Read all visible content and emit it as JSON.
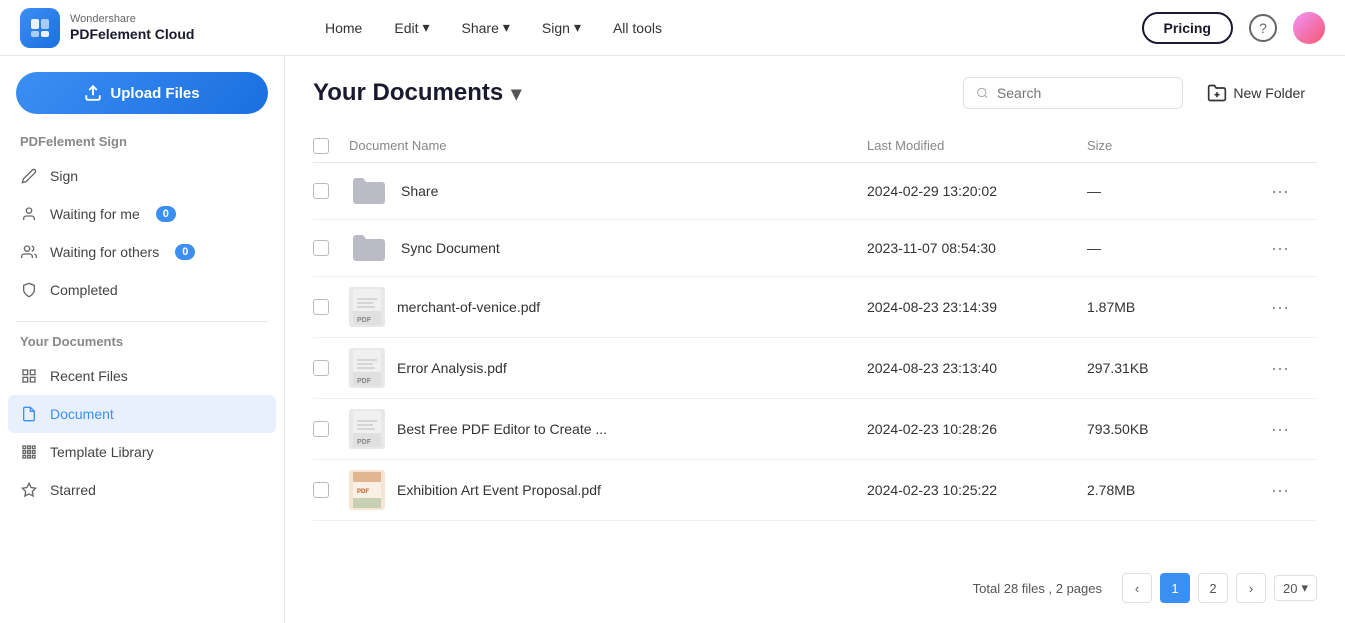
{
  "app": {
    "brand": "Wondershare",
    "product": "PDFelement Cloud"
  },
  "nav": {
    "links": [
      {
        "label": "Home",
        "has_arrow": false
      },
      {
        "label": "Edit",
        "has_arrow": true
      },
      {
        "label": "Share",
        "has_arrow": true
      },
      {
        "label": "Sign",
        "has_arrow": true
      },
      {
        "label": "All tools",
        "has_arrow": false
      }
    ],
    "pricing_label": "Pricing",
    "help_icon": "?",
    "upload_label": "Upload Files"
  },
  "sidebar": {
    "sign_section_label": "PDFelement Sign",
    "sign_items": [
      {
        "id": "sign",
        "label": "Sign"
      },
      {
        "id": "waiting-for-me",
        "label": "Waiting for me",
        "badge": "0"
      },
      {
        "id": "waiting-for-others",
        "label": "Waiting for others",
        "badge": "0"
      },
      {
        "id": "completed",
        "label": "Completed"
      }
    ],
    "docs_section_label": "Your Documents",
    "doc_items": [
      {
        "id": "recent-files",
        "label": "Recent Files"
      },
      {
        "id": "document",
        "label": "Document",
        "active": true
      },
      {
        "id": "template-library",
        "label": "Template Library"
      },
      {
        "id": "starred",
        "label": "Starred"
      }
    ]
  },
  "content": {
    "title": "Your Documents",
    "search_placeholder": "Search",
    "new_folder_label": "New Folder",
    "columns": {
      "name": "Document Name",
      "modified": "Last Modified",
      "size": "Size"
    },
    "files": [
      {
        "id": 1,
        "name": "Share",
        "type": "folder",
        "modified": "2024-02-29 13:20:02",
        "size": "—"
      },
      {
        "id": 2,
        "name": "Sync Document",
        "type": "folder",
        "modified": "2023-11-07 08:54:30",
        "size": "—"
      },
      {
        "id": 3,
        "name": "merchant-of-venice.pdf",
        "type": "pdf",
        "modified": "2024-08-23 23:14:39",
        "size": "1.87MB"
      },
      {
        "id": 4,
        "name": "Error Analysis.pdf",
        "type": "pdf",
        "modified": "2024-08-23 23:13:40",
        "size": "297.31KB"
      },
      {
        "id": 5,
        "name": "Best Free PDF Editor to Create ...",
        "type": "pdf",
        "modified": "2024-02-23 10:28:26",
        "size": "793.50KB"
      },
      {
        "id": 6,
        "name": "Exhibition Art Event Proposal.pdf",
        "type": "pdf_color",
        "modified": "2024-02-23 10:25:22",
        "size": "2.78MB"
      }
    ],
    "pagination": {
      "total_label": "Total 28 files , 2 pages",
      "current_page": 1,
      "pages": [
        1,
        2
      ],
      "per_page": "20"
    }
  }
}
